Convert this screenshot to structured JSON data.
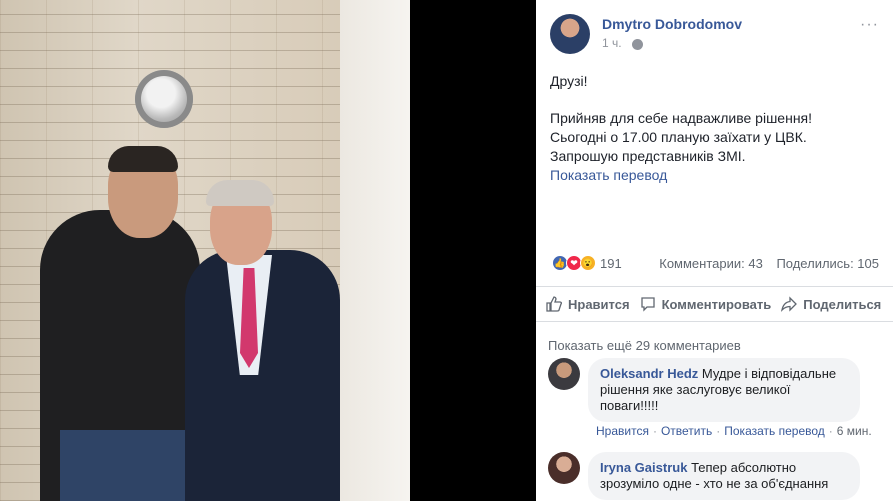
{
  "post": {
    "author": "Dmytro Dobrodomov",
    "time": "1 ч.",
    "more_glyph": "···",
    "greeting": "Друзі!",
    "lines": [
      "Прийняв для себе надважливе рішення!",
      "Сьогодні о 17.00 планую заїхати у ЦВК.",
      "Запрошую представників ЗМІ."
    ],
    "translate": "Показать перевод"
  },
  "stats": {
    "reactions_count": "191",
    "comments": "Комментарии: 43",
    "shares": "Поделились: 105"
  },
  "actions": {
    "like": "Нравится",
    "comment": "Комментировать",
    "share": "Поделиться"
  },
  "comments_section": {
    "show_more": "Показать ещё 29 комментариев",
    "items": [
      {
        "name": "Oleksandr Hedz",
        "text": "Мудре і відповідальне рішення яке заслуговує великої поваги!!!!!",
        "like": "Нравится",
        "reply": "Ответить",
        "translate": "Показать перевод",
        "time": "6 мин."
      },
      {
        "name": "Iryna Gaistruk",
        "text": "Тепер абсолютно зрозуміло одне - хто не за об'єднання"
      }
    ]
  },
  "icons": {
    "like": "thumbs-up-icon",
    "comment": "speech-bubble-icon",
    "share": "share-arrow-icon",
    "globe": "globe-icon",
    "more": "more-icon"
  },
  "colors": {
    "link": "#385898",
    "meta": "#606770",
    "like_reaction": "#4267b2",
    "love_reaction": "#f0284a",
    "wow_reaction": "#f7b125"
  }
}
